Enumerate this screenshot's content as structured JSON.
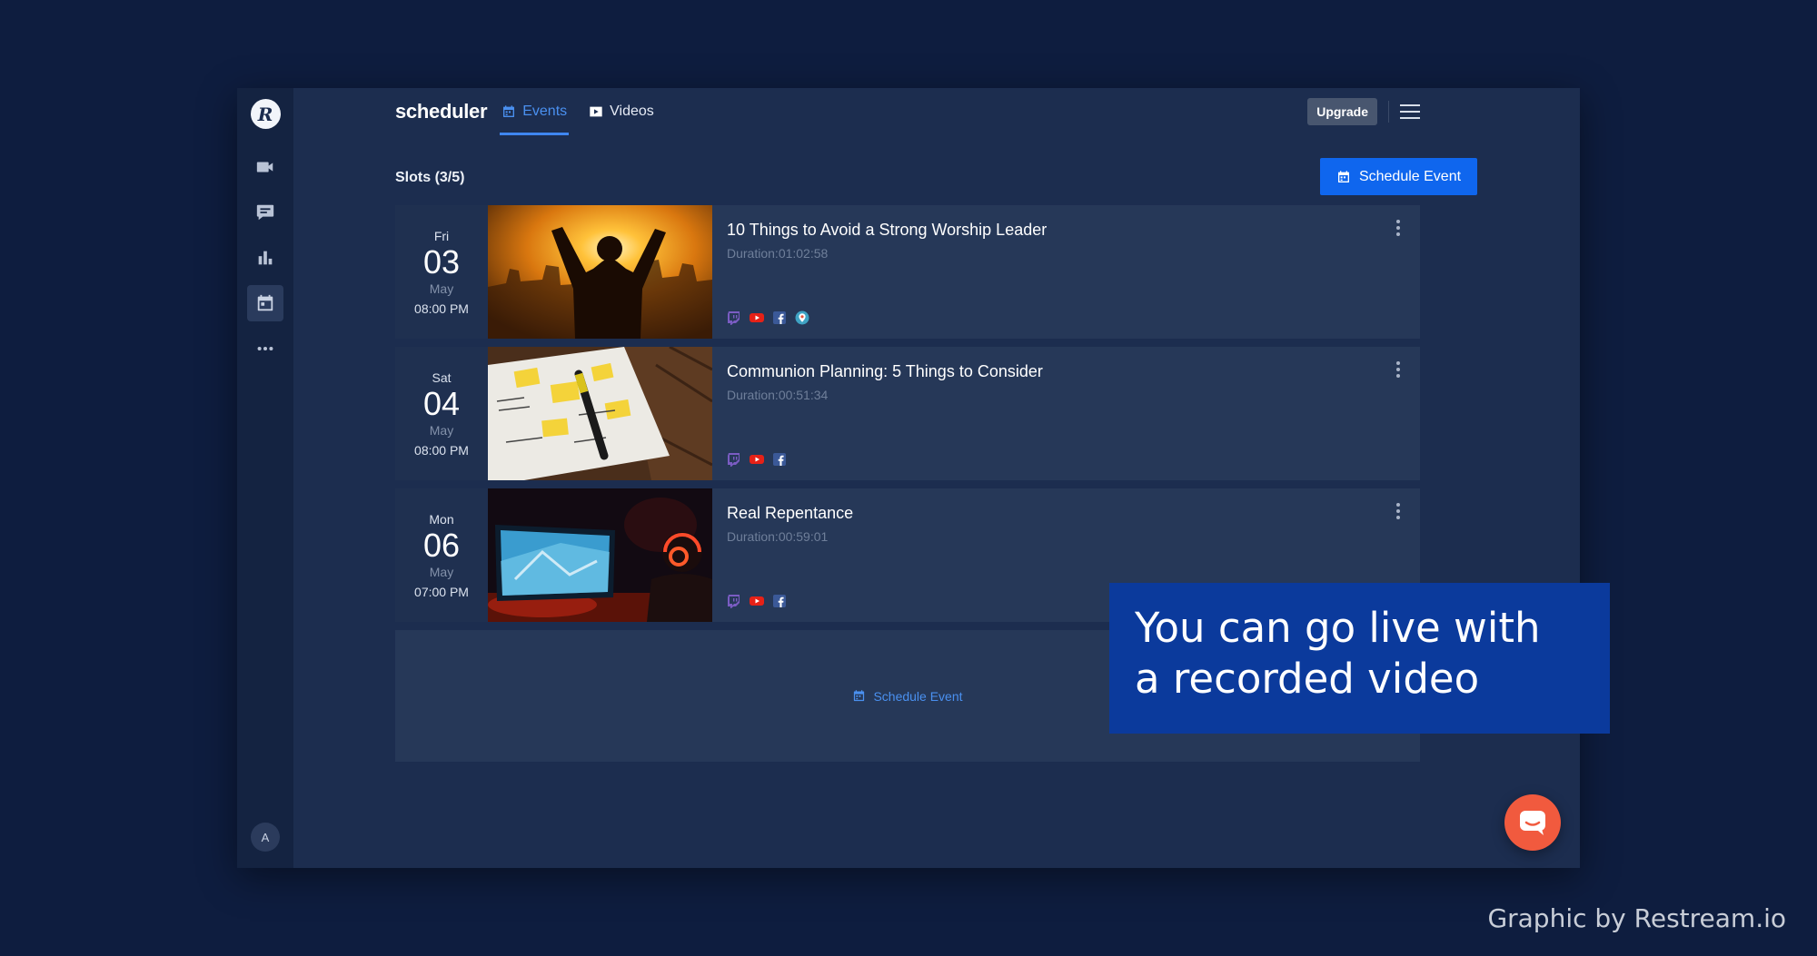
{
  "sidebar": {
    "logo": "R",
    "items": [
      {
        "icon": "video-camera-icon"
      },
      {
        "icon": "chat-icon"
      },
      {
        "icon": "analytics-icon"
      },
      {
        "icon": "calendar-icon",
        "active": true
      },
      {
        "icon": "more-icon"
      }
    ],
    "avatar": "A"
  },
  "header": {
    "brand": "scheduler",
    "tabs": [
      {
        "label": "Events",
        "active": true
      },
      {
        "label": "Videos",
        "active": false
      }
    ],
    "upgrade_label": "Upgrade"
  },
  "main": {
    "slots_label": "Slots (3/5)",
    "schedule_button": "Schedule Event",
    "events": [
      {
        "day": "Fri",
        "date": "03",
        "month": "May",
        "time": "08:00 PM",
        "title": "10 Things to Avoid a Strong Worship Leader",
        "duration_label": "Duration:",
        "duration": "01:02:58",
        "platforms": [
          "twitch",
          "youtube",
          "facebook",
          "periscope"
        ]
      },
      {
        "day": "Sat",
        "date": "04",
        "month": "May",
        "time": "08:00 PM",
        "title": "Communion Planning: 5 Things to Consider",
        "duration_label": "Duration:",
        "duration": "00:51:34",
        "platforms": [
          "twitch",
          "youtube",
          "facebook"
        ]
      },
      {
        "day": "Mon",
        "date": "06",
        "month": "May",
        "time": "07:00 PM",
        "title": "Real Repentance",
        "duration_label": "Duration:",
        "duration": "00:59:01",
        "platforms": [
          "twitch",
          "youtube",
          "facebook"
        ]
      }
    ],
    "empty_slot_label": "Schedule Event"
  },
  "callout": {
    "line1": "You can go live with",
    "line2": "a recorded video"
  },
  "credit": "Graphic by Restream.io",
  "colors": {
    "accent": "#0f66ee",
    "background": "#0e1d3f",
    "panel": "#1c2d4f",
    "card": "#263858",
    "chat": "#f15a3e",
    "callout": "#0b3a9c"
  }
}
